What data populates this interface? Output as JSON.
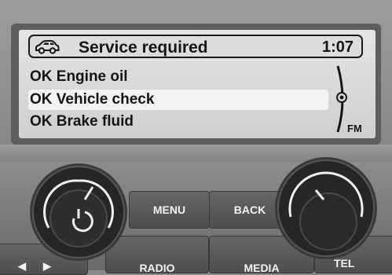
{
  "display": {
    "header": {
      "title": "Service required",
      "time": "1:07",
      "icon": "car-icon"
    },
    "rows": [
      {
        "label": "OK Engine oil",
        "selected": false
      },
      {
        "label": "OK Vehicle check",
        "selected": true
      },
      {
        "label": "OK Brake fluid",
        "selected": false
      }
    ],
    "band": "FM"
  },
  "controls": {
    "menu_label": "MENU",
    "back_label": "BACK",
    "radio_label": "RADIO",
    "media_label": "MEDIA",
    "tel_label": "TEL",
    "left_knob_icon": "power-icon",
    "seek_icons": [
      "seek-back-icon",
      "seek-forward-icon"
    ]
  },
  "colors": {
    "screen_bg": "#dcdcdc",
    "selection": "#f2f2f2",
    "text": "#151515",
    "button_label": "#f2f2f2"
  }
}
